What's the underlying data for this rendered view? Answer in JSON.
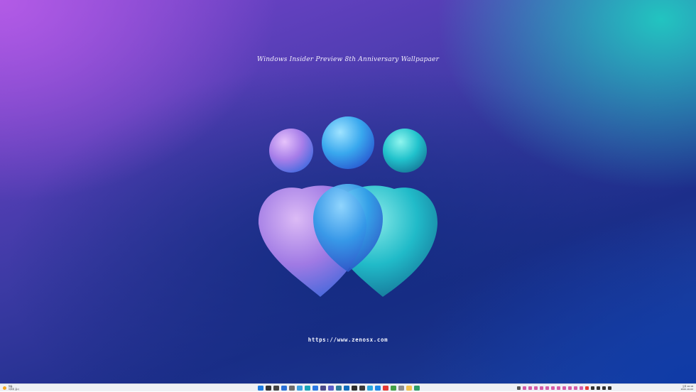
{
  "wallpaper": {
    "title": "Windows Insider Preview 8th Anniversary Wallpapaer",
    "url": "https://www.zenosx.com",
    "logo_icon": "windows-insider-hearts-icon"
  },
  "taskbar": {
    "weather": {
      "line1": "맑음",
      "line2": "이미지 표시",
      "icon": "sun-icon"
    },
    "clock": {
      "time": "오후 10:18",
      "date": "2022-10-02"
    },
    "pinned_icons": [
      {
        "name": "start-icon",
        "color": "#1c7be0"
      },
      {
        "name": "search-icon",
        "color": "#333333"
      },
      {
        "name": "task-view-icon",
        "color": "#444444"
      },
      {
        "name": "widgets-icon",
        "color": "#2a6fd6"
      },
      {
        "name": "settings-icon",
        "color": "#6c6c6c"
      },
      {
        "name": "photos-icon",
        "color": "#3aa0e0"
      },
      {
        "name": "edge-icon",
        "color": "#1aa5b8"
      },
      {
        "name": "todo-icon",
        "color": "#2b78e4"
      },
      {
        "name": "store-icon",
        "color": "#4a4a8a"
      },
      {
        "name": "teams-icon",
        "color": "#5b5fc7"
      },
      {
        "name": "calendar-icon",
        "color": "#2d7d9a"
      },
      {
        "name": "mail-icon",
        "color": "#0f6cbd"
      },
      {
        "name": "terminal-icon",
        "color": "#2d2d2d"
      },
      {
        "name": "app-dark-icon",
        "color": "#3a3a3a"
      },
      {
        "name": "telegram-icon",
        "color": "#29a8e0"
      },
      {
        "name": "browser-icon",
        "color": "#1e88e5"
      },
      {
        "name": "youtube-icon",
        "color": "#e53935"
      },
      {
        "name": "chrome-icon",
        "color": "#43a047"
      },
      {
        "name": "clipboard-icon",
        "color": "#8d8d8d"
      },
      {
        "name": "folder-icon",
        "color": "#f2c14e"
      },
      {
        "name": "app-green-icon",
        "color": "#2e9e6a"
      }
    ],
    "tray_icons": [
      {
        "name": "chevron-up-icon",
        "color": "#555555"
      },
      {
        "name": "tray-pink-1-icon",
        "color": "#d45ca8"
      },
      {
        "name": "tray-pink-2-icon",
        "color": "#d45ca8"
      },
      {
        "name": "tray-pink-3-icon",
        "color": "#d45ca8"
      },
      {
        "name": "tray-pink-4-icon",
        "color": "#d45ca8"
      },
      {
        "name": "tray-pink-5-icon",
        "color": "#d45ca8"
      },
      {
        "name": "tray-pink-6-icon",
        "color": "#d45ca8"
      },
      {
        "name": "tray-pink-7-icon",
        "color": "#d45ca8"
      },
      {
        "name": "tray-pink-8-icon",
        "color": "#d45ca8"
      },
      {
        "name": "tray-pink-9-icon",
        "color": "#d45ca8"
      },
      {
        "name": "tray-pink-10-icon",
        "color": "#d45ca8"
      },
      {
        "name": "tray-pink-11-icon",
        "color": "#d45ca8"
      },
      {
        "name": "tray-red-icon",
        "color": "#e53935"
      },
      {
        "name": "tray-dark-icon",
        "color": "#333333"
      },
      {
        "name": "network-icon",
        "color": "#333333"
      },
      {
        "name": "volume-icon",
        "color": "#333333"
      },
      {
        "name": "battery-icon",
        "color": "#333333"
      }
    ]
  }
}
